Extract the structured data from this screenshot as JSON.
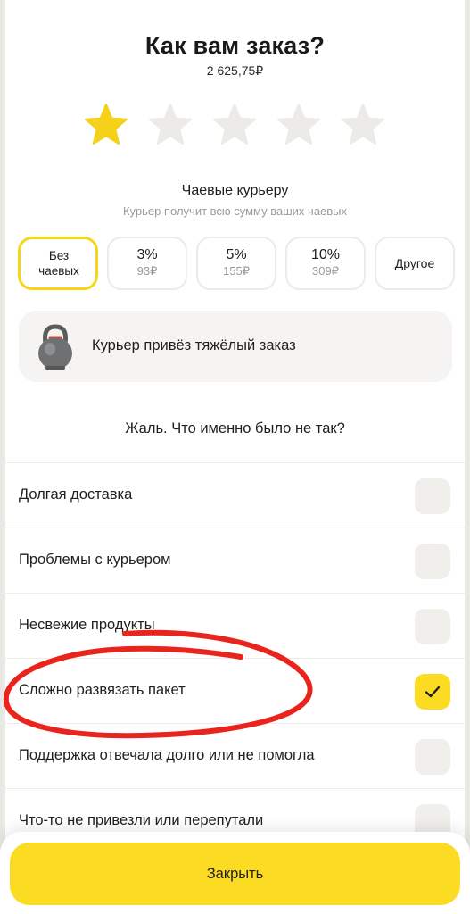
{
  "header": {
    "title": "Как вам заказ?",
    "amount": "2 625,75₽"
  },
  "rating": {
    "value": 1,
    "max": 5,
    "filled_color": "#f5d11a",
    "empty_color": "#ecebe8"
  },
  "tips": {
    "title": "Чаевые курьеру",
    "subtitle": "Курьер получит всю сумму ваших чаевых",
    "options": [
      {
        "label": "Без чаевых",
        "selected": true
      },
      {
        "label": "3%",
        "amount": "93₽"
      },
      {
        "label": "5%",
        "amount": "155₽"
      },
      {
        "label": "10%",
        "amount": "309₽"
      },
      {
        "label": "Другое"
      }
    ]
  },
  "banner": {
    "icon": "kettlebell-icon",
    "text": "Курьер привёз тяжёлый заказ"
  },
  "feedback": {
    "question": "Жаль. Что именно было не так?",
    "options": [
      {
        "label": "Долгая доставка",
        "checked": false
      },
      {
        "label": "Проблемы с курьером",
        "checked": false
      },
      {
        "label": "Несвежие продукты",
        "checked": false
      },
      {
        "label": "Сложно развязать пакет",
        "checked": true
      },
      {
        "label": "Поддержка отвечала долго или не помогла",
        "checked": false
      },
      {
        "label": "Что-то не привезли или перепутали",
        "checked": false
      }
    ]
  },
  "footer": {
    "close_label": "Закрыть"
  },
  "colors": {
    "accent": "#fbdc23",
    "annotation": "#e8241c"
  }
}
